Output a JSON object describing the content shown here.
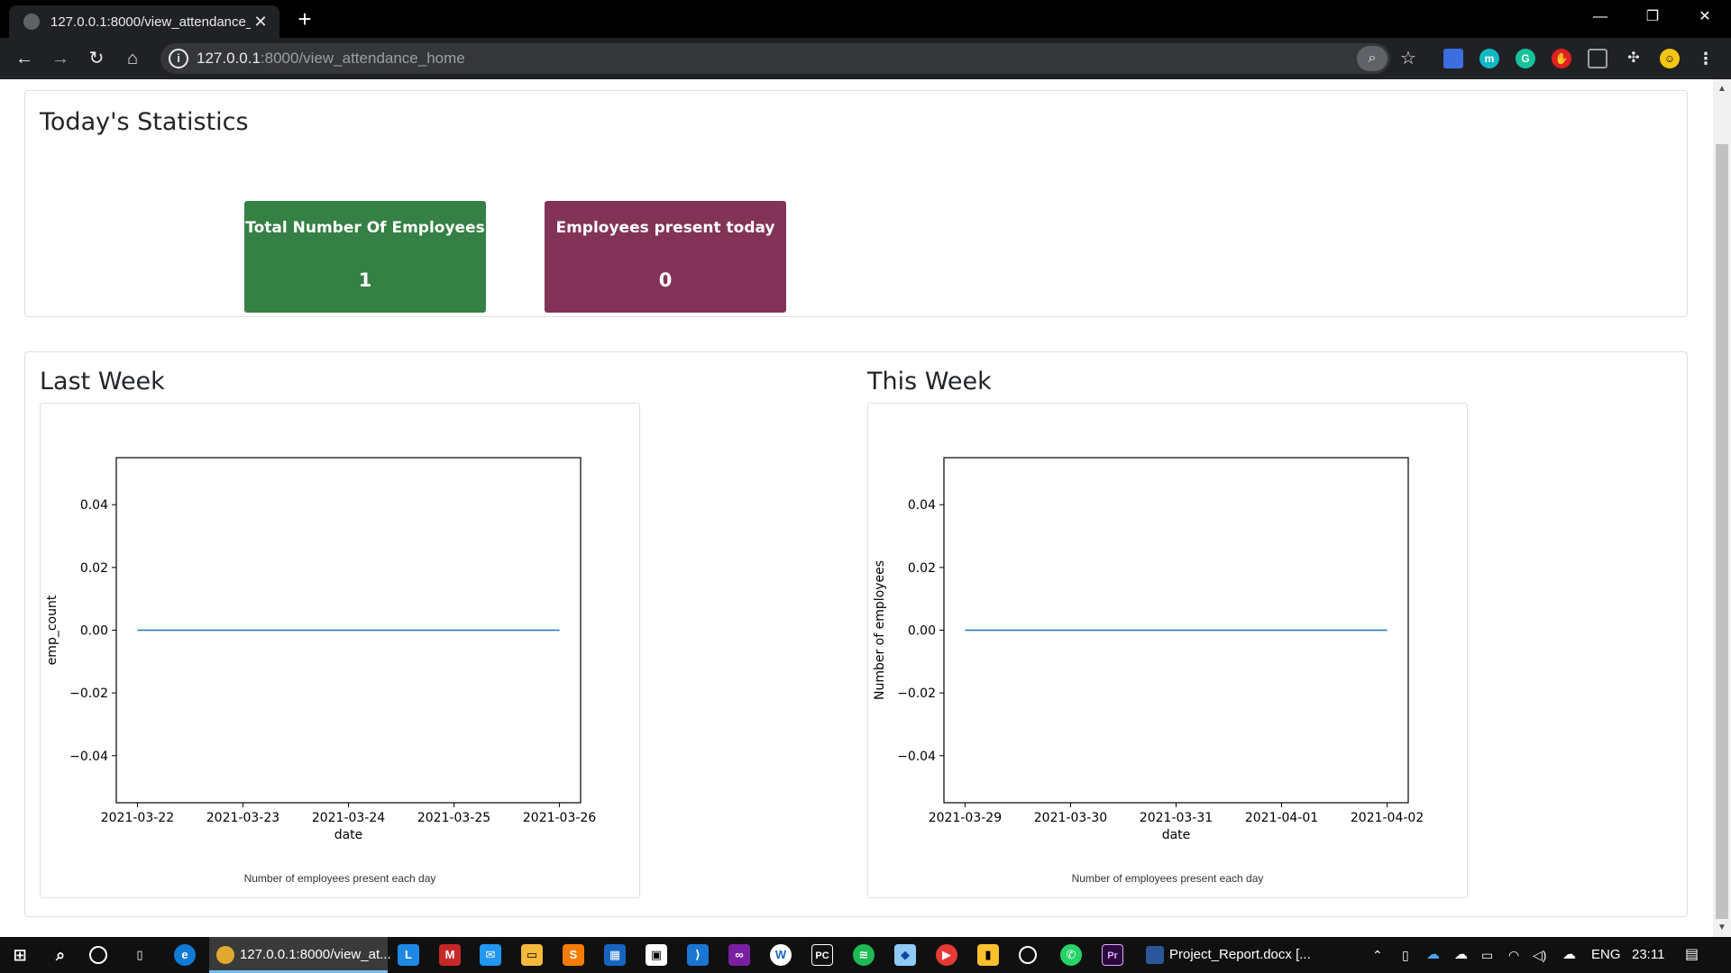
{
  "browser": {
    "tab_title": "127.0.0.1:8000/view_attendance_",
    "url_host": "127.0.0.1",
    "url_rest": ":8000/view_attendance_home"
  },
  "stats_section": {
    "title": "Today's Statistics",
    "cards": [
      {
        "label": "Total Number Of Employees",
        "value": "1",
        "color": "#358044"
      },
      {
        "label": "Employees present today",
        "value": "0",
        "color": "#833358"
      }
    ]
  },
  "last_week": {
    "title": "Last Week",
    "caption": "Number of employees present each day"
  },
  "this_week": {
    "title": "This Week",
    "caption": "Number of employees present each day"
  },
  "chart_data": [
    {
      "type": "line",
      "x": [
        "2021-03-22",
        "2021-03-23",
        "2021-03-24",
        "2021-03-25",
        "2021-03-26"
      ],
      "series": [
        {
          "values": [
            0,
            0,
            0,
            0,
            0
          ],
          "color": "#1f77b4"
        }
      ],
      "xlabel": "date",
      "ylabel": "emp_count",
      "ylim": [
        -0.055,
        0.055
      ],
      "yticks": [
        "0.04",
        "0.02",
        "0.00",
        "−0.02",
        "−0.04"
      ],
      "ytick_values": [
        0.04,
        0.02,
        0,
        -0.02,
        -0.04
      ],
      "grid": false
    },
    {
      "type": "line",
      "x": [
        "2021-03-29",
        "2021-03-30",
        "2021-03-31",
        "2021-04-01",
        "2021-04-02"
      ],
      "series": [
        {
          "values": [
            0,
            0,
            0,
            0,
            0
          ],
          "color": "#1f77b4"
        }
      ],
      "xlabel": "date",
      "ylabel": "Number of employees",
      "ylim": [
        -0.055,
        0.055
      ],
      "yticks": [
        "0.04",
        "0.02",
        "0.00",
        "−0.02",
        "−0.04"
      ],
      "ytick_values": [
        0.04,
        0.02,
        0,
        -0.02,
        -0.04
      ],
      "grid": false
    }
  ],
  "taskbar": {
    "chrome_item": "127.0.0.1:8000/view_at...",
    "word_item": "Project_Report.docx [...",
    "lang": "ENG",
    "time": "23:11"
  }
}
